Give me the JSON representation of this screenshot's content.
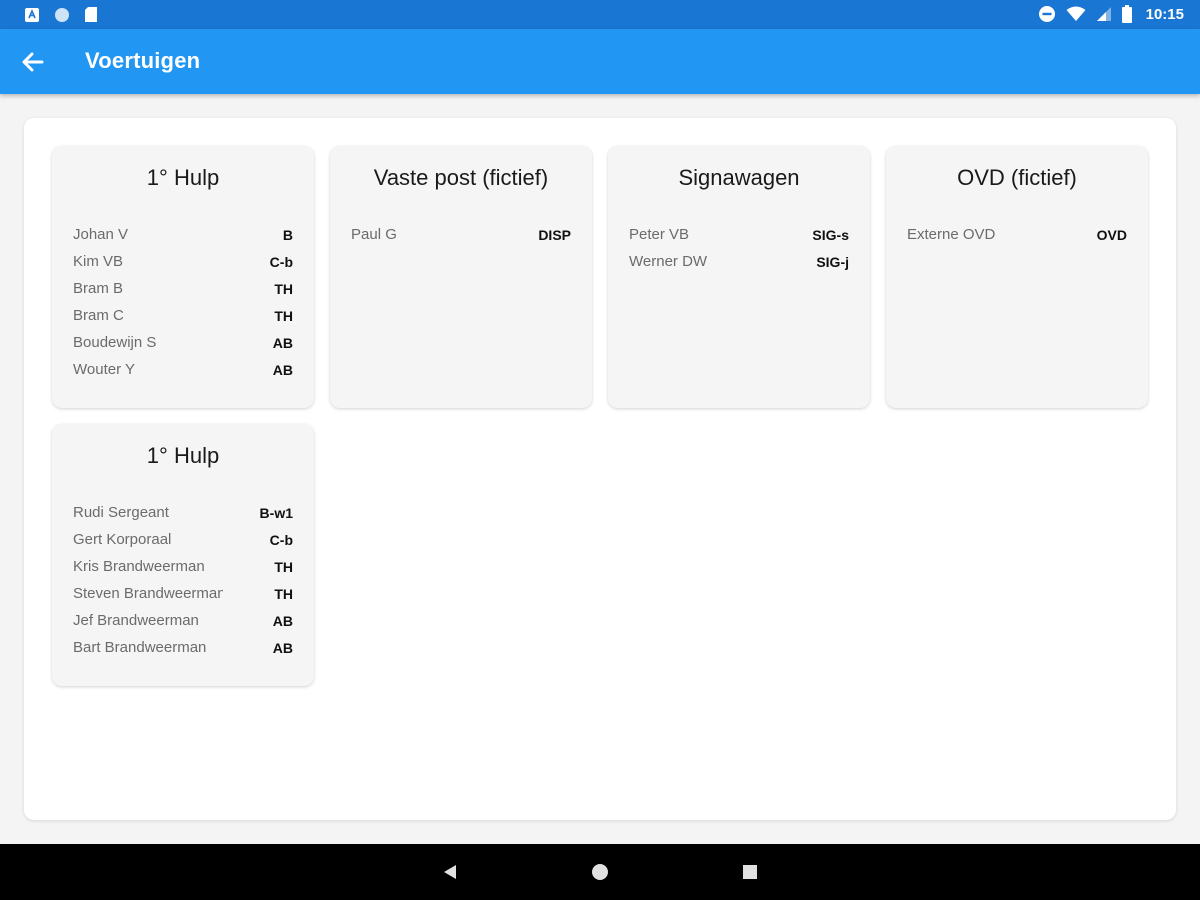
{
  "status_bar": {
    "left_icons": [
      "notification-app-icon",
      "circle-notification-icon",
      "sd-card-icon"
    ],
    "right_icons": [
      "do-not-disturb-icon",
      "wifi-icon",
      "cell-signal-icon",
      "battery-icon"
    ],
    "time": "10:15"
  },
  "app_bar": {
    "back_icon": "arrow-back-icon",
    "title": "Voertuigen"
  },
  "vehicles": [
    {
      "title": "1° Hulp",
      "crew": [
        {
          "name": "Johan V",
          "role": "B"
        },
        {
          "name": "Kim VB",
          "role": "C-b"
        },
        {
          "name": "Bram B",
          "role": "TH"
        },
        {
          "name": "Bram C",
          "role": "TH"
        },
        {
          "name": "Boudewijn S",
          "role": "AB"
        },
        {
          "name": "Wouter Y",
          "role": "AB"
        }
      ]
    },
    {
      "title": "Vaste post (fictief)",
      "crew": [
        {
          "name": "Paul G",
          "role": "DISP"
        }
      ]
    },
    {
      "title": "Signawagen",
      "crew": [
        {
          "name": "Peter VB",
          "role": "SIG-s"
        },
        {
          "name": "Werner DW",
          "role": "SIG-j"
        }
      ]
    },
    {
      "title": "OVD (fictief)",
      "crew": [
        {
          "name": "Externe OVD",
          "role": "OVD"
        }
      ]
    },
    {
      "title": "1° Hulp",
      "crew": [
        {
          "name": "Rudi Sergeant",
          "role": "B-w1"
        },
        {
          "name": "Gert Korporaal",
          "role": "C-b"
        },
        {
          "name": "Kris Brandweerman",
          "role": "TH"
        },
        {
          "name": "Steven Brandweerman",
          "role": "TH"
        },
        {
          "name": "Jef Brandweerman",
          "role": "AB"
        },
        {
          "name": "Bart Brandweerman",
          "role": "AB"
        }
      ]
    }
  ],
  "nav_bar": {
    "icons": [
      "back-triangle-icon",
      "home-circle-icon",
      "recents-square-icon"
    ]
  },
  "colors": {
    "status_bar": "#1976d2",
    "app_bar": "#2196f3",
    "card_bg": "#f5f5f5",
    "page_bg": "#f4f4f4"
  }
}
